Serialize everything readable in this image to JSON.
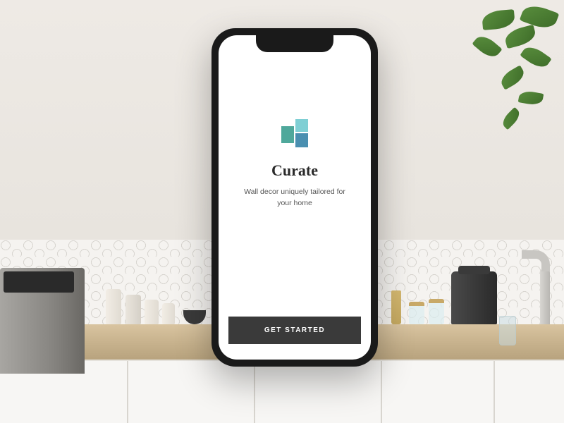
{
  "app": {
    "name": "Curate",
    "tagline": "Wall decor uniquely tailored for your home",
    "cta_label": "GET STARTED"
  },
  "logo": {
    "colors": {
      "block1": "#4fa89b",
      "block2": "#7fcfd4",
      "block3": "#4a8fb0"
    }
  }
}
